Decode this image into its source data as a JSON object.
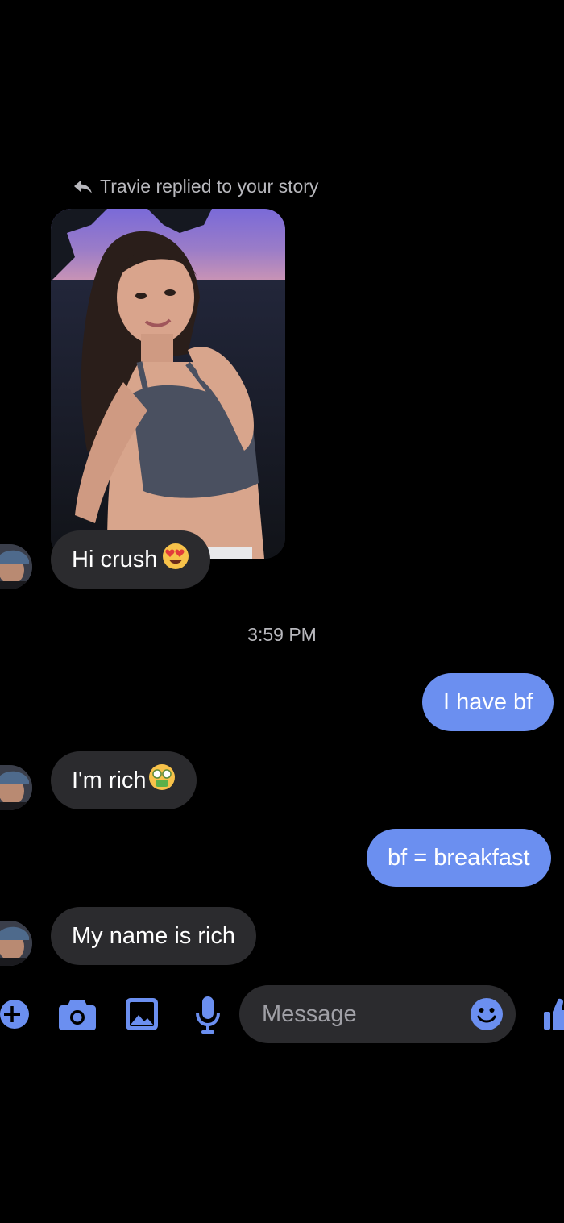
{
  "colors": {
    "background": "#000000",
    "accent": "#6b8ff0",
    "incoming_bubble": "#2b2b2e",
    "secondary_text": "#b8b8bd"
  },
  "story_reply": {
    "header": "Travie replied to your story",
    "header_icon": "reply-arrow-icon",
    "image": "story-photo"
  },
  "timestamp": "3:59 PM",
  "messages": [
    {
      "from": "them",
      "text": "Hi crush",
      "emoji": "heart-eyes-emoji"
    },
    {
      "from": "me",
      "text": "I have bf"
    },
    {
      "from": "them",
      "text": "I'm rich",
      "emoji": "money-mouth-emoji"
    },
    {
      "from": "me",
      "text": "bf = breakfast"
    },
    {
      "from": "them",
      "text": "My name is rich"
    }
  ],
  "composer": {
    "placeholder": "Message",
    "icons": [
      "plus-icon",
      "camera-icon",
      "gallery-icon",
      "microphone-icon",
      "emoji-icon",
      "thumbs-up-icon"
    ]
  }
}
